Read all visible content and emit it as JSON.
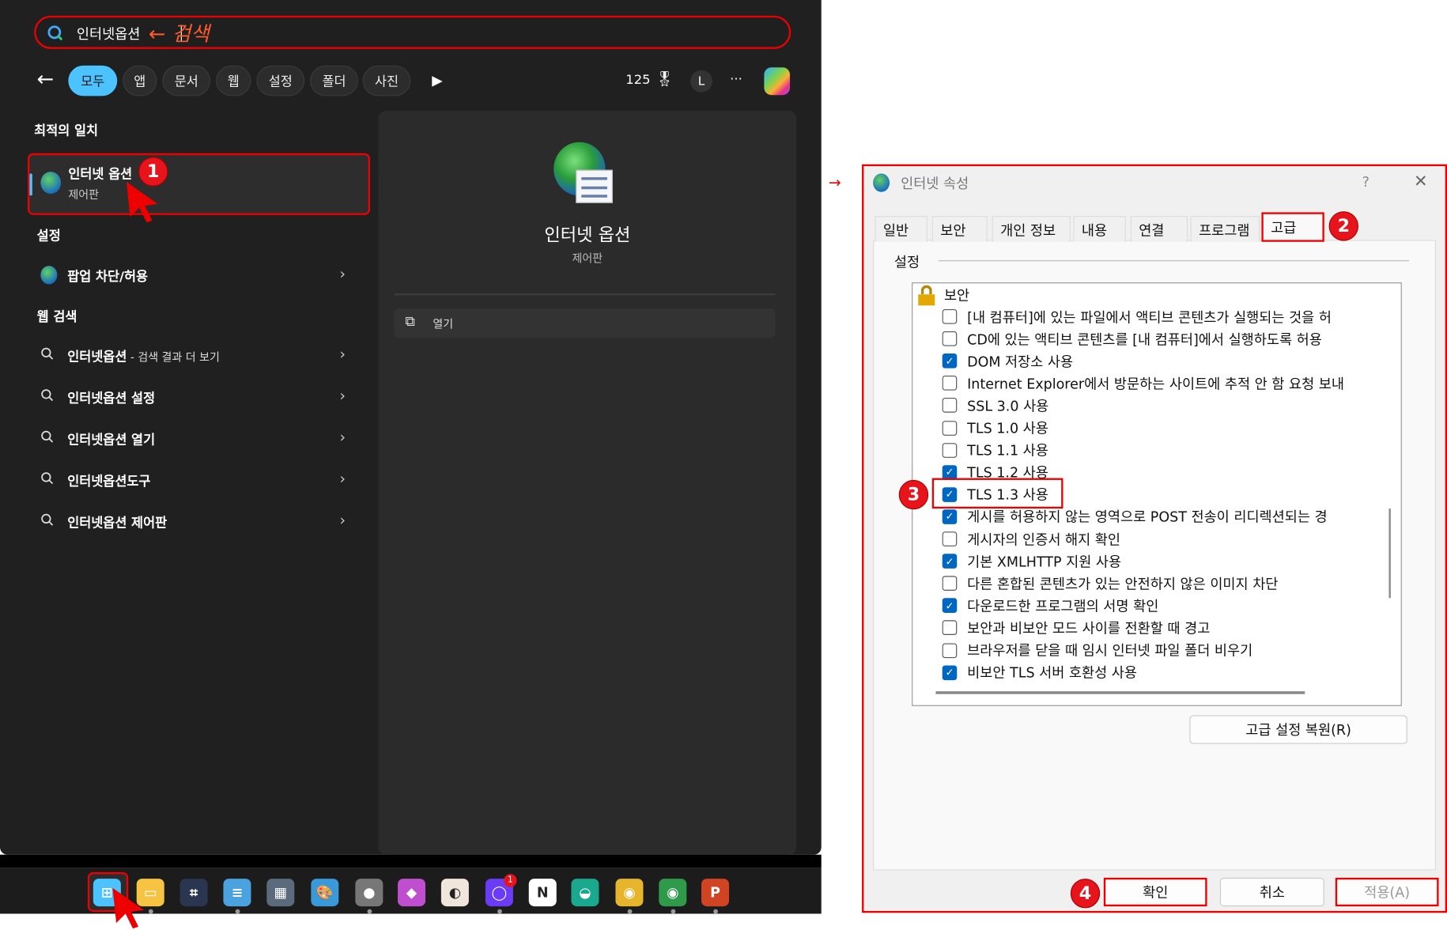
{
  "search": {
    "query": "인터넷옵션",
    "annotation": "← 검색"
  },
  "filters": {
    "tabs": [
      "모두",
      "앱",
      "문서",
      "웹",
      "설정",
      "폴더",
      "사진"
    ],
    "active": "모두",
    "points": "125",
    "user_initial": "L",
    "more": "···"
  },
  "best_match": {
    "heading": "최적의 일치",
    "title": "인터넷 옵션",
    "subtitle": "제어판",
    "badge": "1"
  },
  "settings": {
    "heading": "설정",
    "items": [
      {
        "label": "팝업 차단/허용"
      }
    ]
  },
  "web_search": {
    "heading": "웹 검색",
    "items": [
      {
        "prefix": "인터넷옵션",
        "suffix": " - 검색 결과 더 보기"
      },
      {
        "prefix": "인터넷옵션 ",
        "suffix": "설정"
      },
      {
        "prefix": "인터넷옵션 ",
        "suffix": "열기"
      },
      {
        "prefix": "인터넷옵션",
        "suffix": "도구"
      },
      {
        "prefix": "인터넷옵션 ",
        "suffix": "제어판"
      }
    ]
  },
  "preview": {
    "title": "인터넷 옵션",
    "subtitle": "제어판",
    "open_label": "열기"
  },
  "dialog": {
    "title": "인터넷 속성",
    "help": "?",
    "close": "✕",
    "tabs": [
      "일반",
      "보안",
      "개인 정보",
      "내용",
      "연결",
      "프로그램",
      "고급"
    ],
    "active_tab": "고급",
    "tab_badge": "2",
    "group_label": "설정",
    "category": "보안",
    "options": [
      {
        "label": "[내 컴퓨터]에 있는 파일에서 액티브 콘텐츠가 실행되는 것을 허",
        "checked": false
      },
      {
        "label": "CD에 있는 액티브 콘텐츠를 [내 컴퓨터]에서 실행하도록 허용",
        "checked": false
      },
      {
        "label": "DOM 저장소 사용",
        "checked": true
      },
      {
        "label": "Internet Explorer에서 방문하는 사이트에 추적 안 함 요청 보내",
        "checked": false
      },
      {
        "label": "SSL 3.0 사용",
        "checked": false
      },
      {
        "label": "TLS 1.0 사용",
        "checked": false
      },
      {
        "label": "TLS 1.1 사용",
        "checked": false
      },
      {
        "label": "TLS 1.2 사용",
        "checked": true
      },
      {
        "label": "TLS 1.3 사용",
        "checked": true
      },
      {
        "label": "게시를 허용하지 않는 영역으로 POST 전송이 리디렉션되는 경",
        "checked": true
      },
      {
        "label": "게시자의 인증서 해지 확인",
        "checked": false
      },
      {
        "label": "기본 XMLHTTP 지원 사용",
        "checked": true
      },
      {
        "label": "다른 혼합된 콘텐츠가 있는 안전하지 않은 이미지 차단",
        "checked": false
      },
      {
        "label": "다운로드한 프로그램의 서명 확인",
        "checked": true
      },
      {
        "label": "보안과 비보안 모드 사이를 전환할 때 경고",
        "checked": false
      },
      {
        "label": "브라우저를 닫을 때 임시 인터넷 파일 폴더 비우기",
        "checked": false
      },
      {
        "label": "비보안 TLS 서버 호환성 사용",
        "checked": true
      }
    ],
    "option_badge": "3",
    "restore_label": "고급 설정 복원(R)",
    "ok_label": "확인",
    "cancel_label": "취소",
    "apply_label": "적용(A)",
    "button_badge": "4"
  },
  "taskbar": {
    "notification_count": "1",
    "icons": [
      "start",
      "file-explorer",
      "snipping",
      "notepad",
      "calculator",
      "paint",
      "apple",
      "fluent-drop",
      "slides",
      "messenger",
      "notion",
      "edge-like",
      "chrome",
      "chrome-profile",
      "powerpoint"
    ]
  }
}
